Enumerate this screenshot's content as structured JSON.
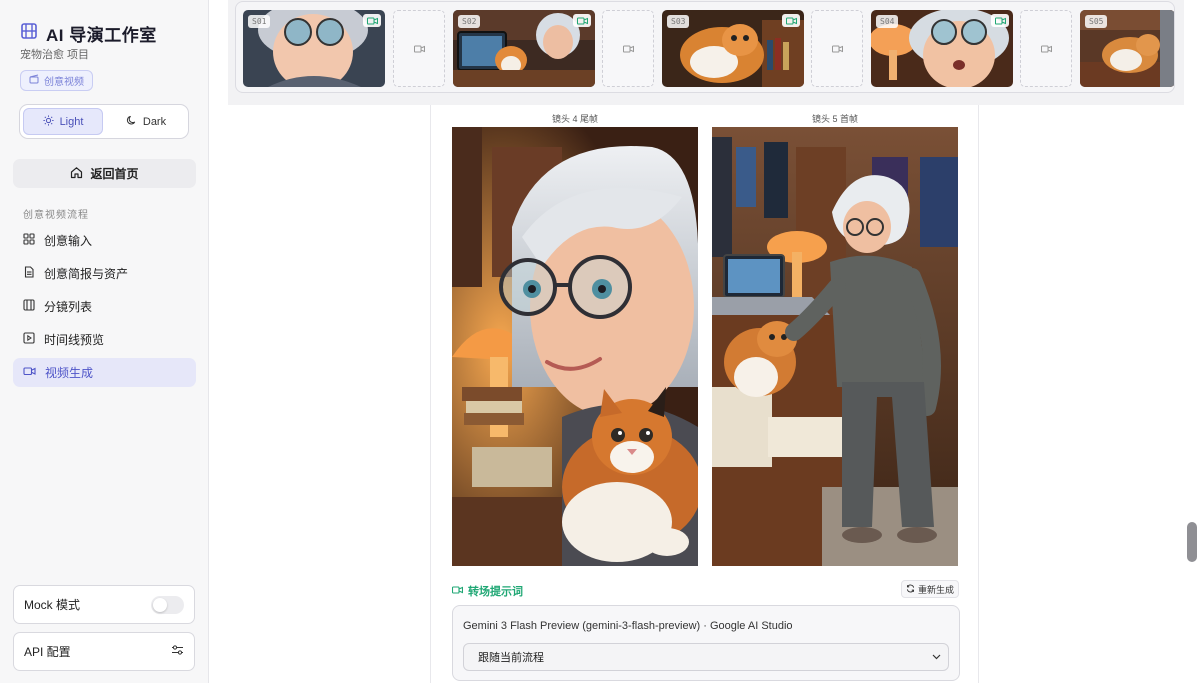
{
  "sidebar": {
    "app_title": "AI 导演工作室",
    "project_name": "宠物治愈 项目",
    "badge": "创意视频",
    "theme": {
      "light": "Light",
      "dark": "Dark",
      "active": "light"
    },
    "home_button": "返回首页",
    "section_label": "创意视频流程",
    "nav": [
      {
        "label": "创意输入",
        "icon": "grid-icon",
        "active": false
      },
      {
        "label": "创意简报与资产",
        "icon": "document-icon",
        "active": false
      },
      {
        "label": "分镜列表",
        "icon": "film-icon",
        "active": false
      },
      {
        "label": "时间线预览",
        "icon": "play-square-icon",
        "active": false
      },
      {
        "label": "视频生成",
        "icon": "video-icon",
        "active": true
      }
    ],
    "mock_mode": {
      "label": "Mock 模式",
      "enabled": false
    },
    "api_config": "API 配置"
  },
  "filmstrip": {
    "shots": [
      {
        "id": "S01",
        "has_video": true
      },
      {
        "id": "S02",
        "has_video": true
      },
      {
        "id": "S03",
        "has_video": true
      },
      {
        "id": "S04",
        "has_video": true
      },
      {
        "id": "S05",
        "has_video": false
      }
    ]
  },
  "transition": {
    "left_label": "镜头 4 尾帧",
    "right_label": "镜头 5 首帧",
    "prompt_title": "转场提示词",
    "regenerate": "重新生成",
    "model_name": "Gemini 3 Flash Preview (gemini-3-flash-preview) · Google AI Studio",
    "select_value": "跟随当前流程"
  },
  "colors": {
    "accent": "#5b61d6",
    "green": "#1fa774",
    "active_nav_bg": "#e6e7f9"
  }
}
